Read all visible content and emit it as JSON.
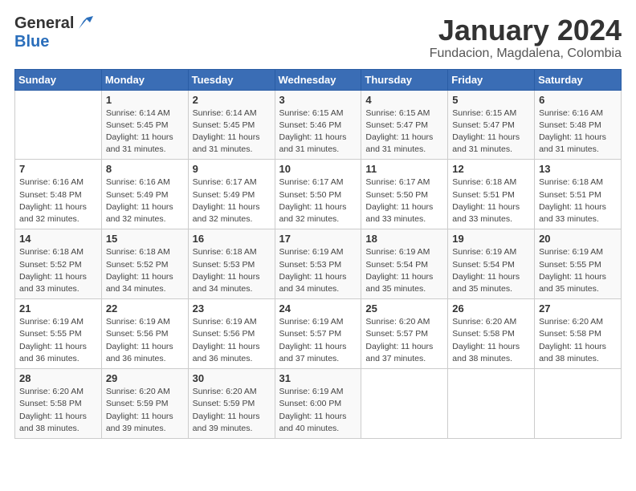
{
  "header": {
    "logo_general": "General",
    "logo_blue": "Blue",
    "month_year": "January 2024",
    "location": "Fundacion, Magdalena, Colombia"
  },
  "days_of_week": [
    "Sunday",
    "Monday",
    "Tuesday",
    "Wednesday",
    "Thursday",
    "Friday",
    "Saturday"
  ],
  "weeks": [
    [
      {
        "day": "",
        "detail": ""
      },
      {
        "day": "1",
        "detail": "Sunrise: 6:14 AM\nSunset: 5:45 PM\nDaylight: 11 hours\nand 31 minutes."
      },
      {
        "day": "2",
        "detail": "Sunrise: 6:14 AM\nSunset: 5:45 PM\nDaylight: 11 hours\nand 31 minutes."
      },
      {
        "day": "3",
        "detail": "Sunrise: 6:15 AM\nSunset: 5:46 PM\nDaylight: 11 hours\nand 31 minutes."
      },
      {
        "day": "4",
        "detail": "Sunrise: 6:15 AM\nSunset: 5:47 PM\nDaylight: 11 hours\nand 31 minutes."
      },
      {
        "day": "5",
        "detail": "Sunrise: 6:15 AM\nSunset: 5:47 PM\nDaylight: 11 hours\nand 31 minutes."
      },
      {
        "day": "6",
        "detail": "Sunrise: 6:16 AM\nSunset: 5:48 PM\nDaylight: 11 hours\nand 31 minutes."
      }
    ],
    [
      {
        "day": "7",
        "detail": "Sunrise: 6:16 AM\nSunset: 5:48 PM\nDaylight: 11 hours\nand 32 minutes."
      },
      {
        "day": "8",
        "detail": "Sunrise: 6:16 AM\nSunset: 5:49 PM\nDaylight: 11 hours\nand 32 minutes."
      },
      {
        "day": "9",
        "detail": "Sunrise: 6:17 AM\nSunset: 5:49 PM\nDaylight: 11 hours\nand 32 minutes."
      },
      {
        "day": "10",
        "detail": "Sunrise: 6:17 AM\nSunset: 5:50 PM\nDaylight: 11 hours\nand 32 minutes."
      },
      {
        "day": "11",
        "detail": "Sunrise: 6:17 AM\nSunset: 5:50 PM\nDaylight: 11 hours\nand 33 minutes."
      },
      {
        "day": "12",
        "detail": "Sunrise: 6:18 AM\nSunset: 5:51 PM\nDaylight: 11 hours\nand 33 minutes."
      },
      {
        "day": "13",
        "detail": "Sunrise: 6:18 AM\nSunset: 5:51 PM\nDaylight: 11 hours\nand 33 minutes."
      }
    ],
    [
      {
        "day": "14",
        "detail": "Sunrise: 6:18 AM\nSunset: 5:52 PM\nDaylight: 11 hours\nand 33 minutes."
      },
      {
        "day": "15",
        "detail": "Sunrise: 6:18 AM\nSunset: 5:52 PM\nDaylight: 11 hours\nand 34 minutes."
      },
      {
        "day": "16",
        "detail": "Sunrise: 6:18 AM\nSunset: 5:53 PM\nDaylight: 11 hours\nand 34 minutes."
      },
      {
        "day": "17",
        "detail": "Sunrise: 6:19 AM\nSunset: 5:53 PM\nDaylight: 11 hours\nand 34 minutes."
      },
      {
        "day": "18",
        "detail": "Sunrise: 6:19 AM\nSunset: 5:54 PM\nDaylight: 11 hours\nand 35 minutes."
      },
      {
        "day": "19",
        "detail": "Sunrise: 6:19 AM\nSunset: 5:54 PM\nDaylight: 11 hours\nand 35 minutes."
      },
      {
        "day": "20",
        "detail": "Sunrise: 6:19 AM\nSunset: 5:55 PM\nDaylight: 11 hours\nand 35 minutes."
      }
    ],
    [
      {
        "day": "21",
        "detail": "Sunrise: 6:19 AM\nSunset: 5:55 PM\nDaylight: 11 hours\nand 36 minutes."
      },
      {
        "day": "22",
        "detail": "Sunrise: 6:19 AM\nSunset: 5:56 PM\nDaylight: 11 hours\nand 36 minutes."
      },
      {
        "day": "23",
        "detail": "Sunrise: 6:19 AM\nSunset: 5:56 PM\nDaylight: 11 hours\nand 36 minutes."
      },
      {
        "day": "24",
        "detail": "Sunrise: 6:19 AM\nSunset: 5:57 PM\nDaylight: 11 hours\nand 37 minutes."
      },
      {
        "day": "25",
        "detail": "Sunrise: 6:20 AM\nSunset: 5:57 PM\nDaylight: 11 hours\nand 37 minutes."
      },
      {
        "day": "26",
        "detail": "Sunrise: 6:20 AM\nSunset: 5:58 PM\nDaylight: 11 hours\nand 38 minutes."
      },
      {
        "day": "27",
        "detail": "Sunrise: 6:20 AM\nSunset: 5:58 PM\nDaylight: 11 hours\nand 38 minutes."
      }
    ],
    [
      {
        "day": "28",
        "detail": "Sunrise: 6:20 AM\nSunset: 5:58 PM\nDaylight: 11 hours\nand 38 minutes."
      },
      {
        "day": "29",
        "detail": "Sunrise: 6:20 AM\nSunset: 5:59 PM\nDaylight: 11 hours\nand 39 minutes."
      },
      {
        "day": "30",
        "detail": "Sunrise: 6:20 AM\nSunset: 5:59 PM\nDaylight: 11 hours\nand 39 minutes."
      },
      {
        "day": "31",
        "detail": "Sunrise: 6:19 AM\nSunset: 6:00 PM\nDaylight: 11 hours\nand 40 minutes."
      },
      {
        "day": "",
        "detail": ""
      },
      {
        "day": "",
        "detail": ""
      },
      {
        "day": "",
        "detail": ""
      }
    ]
  ]
}
